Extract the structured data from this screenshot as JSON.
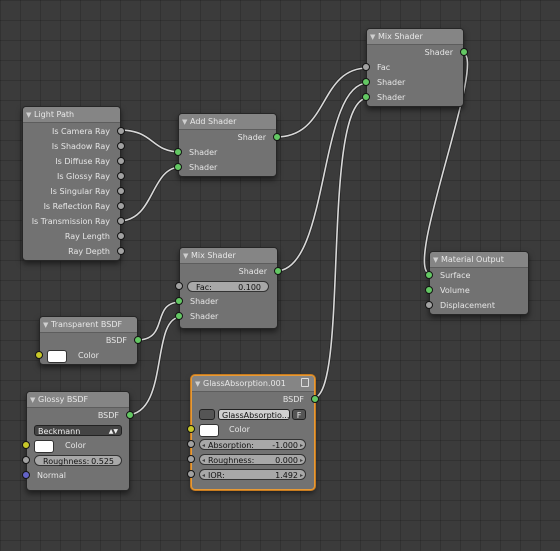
{
  "nodes": {
    "light_path": {
      "title": "Light Path",
      "outputs": [
        "Is Camera Ray",
        "Is Shadow Ray",
        "Is Diffuse Ray",
        "Is Glossy Ray",
        "Is Singular Ray",
        "Is Reflection Ray",
        "Is Transmission Ray",
        "Ray Length",
        "Ray Depth"
      ]
    },
    "add_shader": {
      "title": "Add Shader",
      "output": "Shader",
      "inputs": [
        "Shader",
        "Shader"
      ]
    },
    "mix_shader_top": {
      "title": "Mix Shader",
      "output": "Shader",
      "inputs": [
        "Fac",
        "Shader",
        "Shader"
      ]
    },
    "mix_shader_mid": {
      "title": "Mix Shader",
      "output": "Shader",
      "fac_label": "Fac:",
      "fac_value": "0.100",
      "inputs": [
        "Shader",
        "Shader"
      ]
    },
    "material_output": {
      "title": "Material Output",
      "inputs": [
        "Surface",
        "Volume",
        "Displacement"
      ]
    },
    "transparent_bsdf": {
      "title": "Transparent BSDF",
      "output": "BSDF",
      "color_label": "Color",
      "color": "#ffffff"
    },
    "glossy_bsdf": {
      "title": "Glossy BSDF",
      "output": "BSDF",
      "distribution": "Beckmann",
      "color_label": "Color",
      "color": "#ffffff",
      "roughness_label": "Roughness:",
      "roughness_value": "0.525",
      "normal_label": "Normal"
    },
    "glass_absorption": {
      "title": "GlassAbsorption.001",
      "output": "BSDF",
      "group_name": "GlassAbsorptio...",
      "fake_user": "F",
      "color_label": "Color",
      "color": "#ffffff",
      "absorption_label": "Absorption:",
      "absorption_value": "-1.000",
      "roughness_label": "Roughness:",
      "roughness_value": "0.000",
      "ior_label": "IOR:",
      "ior_value": "1.492"
    }
  },
  "colors": {
    "shader_socket": "#63c763",
    "value_socket": "#a1a1a1",
    "color_socket": "#c7c729",
    "vector_socket": "#6363c7",
    "active_border": "#e79a36",
    "link": "#d8d8d8"
  }
}
